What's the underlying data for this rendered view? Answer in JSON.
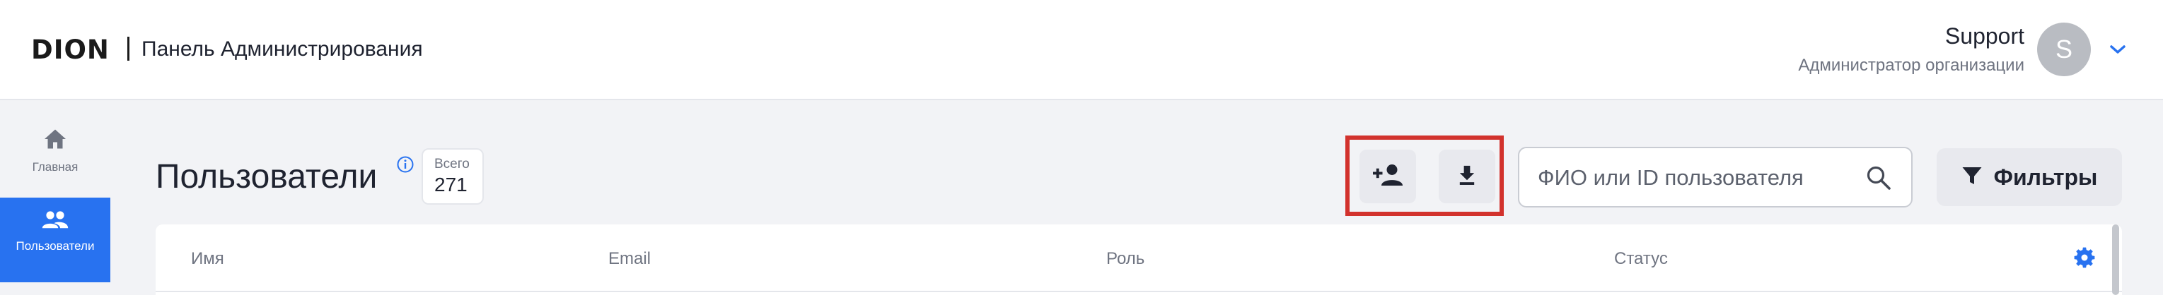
{
  "header": {
    "logo_text": "DION",
    "app_title": "Панель Администрирования",
    "user": {
      "name": "Support",
      "role": "Администратор организации",
      "avatar_letter": "S"
    },
    "menu_icon": "chevron-down-icon"
  },
  "sidebar": {
    "items": [
      {
        "label": "Главная",
        "icon": "home-icon",
        "active": false
      },
      {
        "label": "Пользователи",
        "icon": "users-icon",
        "active": true
      }
    ]
  },
  "main": {
    "title": "Пользователи",
    "total": {
      "label": "Всего",
      "value": "271"
    },
    "actions": {
      "add_user_icon": "add-user-icon",
      "download_icon": "download-icon"
    },
    "search": {
      "placeholder": "ФИО или ID пользователя",
      "value": ""
    },
    "filters_label": "Фильтры",
    "table": {
      "columns": [
        "Имя",
        "Email",
        "Роль",
        "Статус"
      ]
    }
  },
  "colors": {
    "accent": "#2872f0",
    "highlight": "#d2322d",
    "background": "#f2f3f6"
  }
}
